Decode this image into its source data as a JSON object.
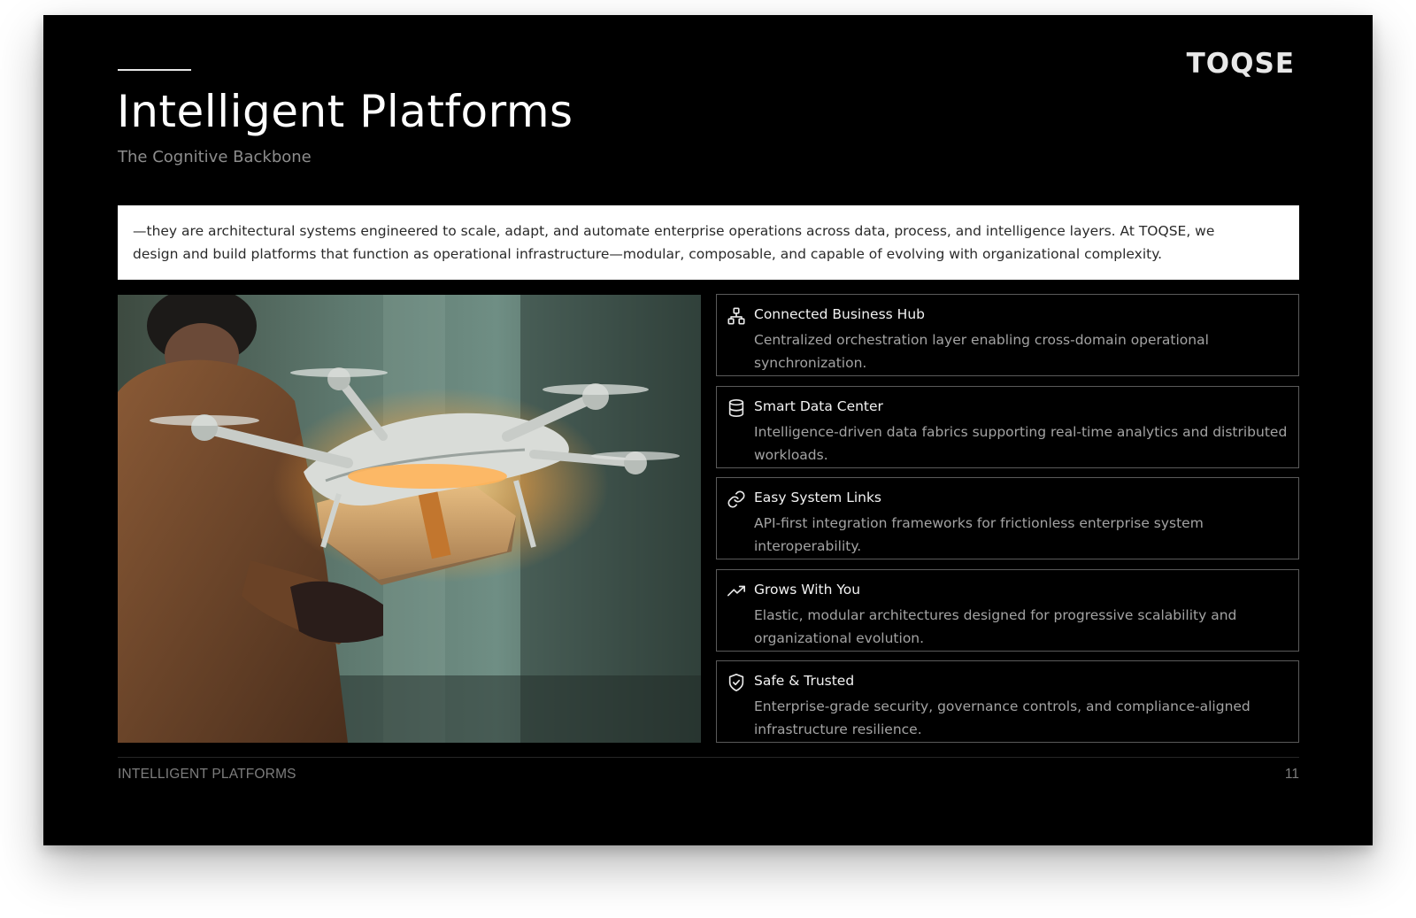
{
  "slide": {
    "brand": "TOQSE",
    "title": "Intelligent Platforms",
    "subtitle": "The Cognitive Backbone",
    "intro": "—they are architectural systems engineered to scale, adapt, and automate enterprise operations across data, process, and intelligence layers. At TOQSE, we design and build platforms that function as operational infrastructure—modular, composable, and capable of evolving with organizational complexity.",
    "image_icon": "drone-delivery-photo"
  },
  "features": [
    {
      "icon": "hierarchy-icon",
      "title": "Connected Business Hub",
      "description": "Centralized orchestration layer enabling cross-domain operational synchronization."
    },
    {
      "icon": "database-icon",
      "title": "Smart Data Center",
      "description": "Intelligence-driven data fabrics supporting real-time analytics and distributed workloads."
    },
    {
      "icon": "link-icon",
      "title": "Easy System Links",
      "description": "API-first integration frameworks for frictionless enterprise system interoperability."
    },
    {
      "icon": "trending-up-icon",
      "title": "Grows With You",
      "description": "Elastic, modular architectures designed for progressive scalability and organizational evolution."
    },
    {
      "icon": "shield-check-icon",
      "title": "Safe & Trusted",
      "description": "Enterprise-grade security, governance controls, and compliance-aligned infrastructure resilience."
    }
  ],
  "footer": {
    "section": "INTELLIGENT PLATFORMS",
    "page_number": "11"
  },
  "colors": {
    "slide_background": "#000000",
    "intro_background": "#ffffff",
    "card_border": "#5a5a5a",
    "muted_text": "#a3a3a3"
  }
}
